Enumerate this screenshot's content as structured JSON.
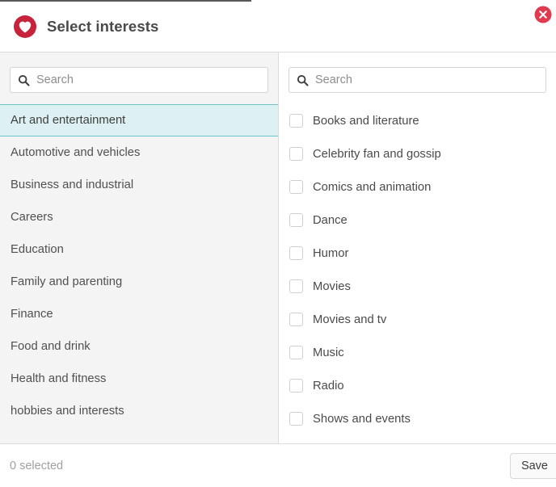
{
  "header": {
    "title": "Select interests",
    "brand_icon": "heart-circle-icon",
    "brand_color": "#c8233c",
    "close_icon": "close-circle-icon",
    "close_color": "#e03a4e"
  },
  "left_panel": {
    "search": {
      "placeholder": "Search",
      "value": "",
      "icon": "search-icon"
    },
    "selected_index": 0,
    "selected_color": "#ddf0f2",
    "selected_border_color": "#6cc3cb",
    "categories": [
      {
        "label": "Art and entertainment"
      },
      {
        "label": "Automotive and vehicles"
      },
      {
        "label": "Business and industrial"
      },
      {
        "label": "Careers"
      },
      {
        "label": "Education"
      },
      {
        "label": "Family and parenting"
      },
      {
        "label": "Finance"
      },
      {
        "label": "Food and drink"
      },
      {
        "label": "Health and fitness"
      },
      {
        "label": "hobbies and interests"
      }
    ]
  },
  "right_panel": {
    "search": {
      "placeholder": "Search",
      "value": "",
      "icon": "search-icon"
    },
    "interests": [
      {
        "label": "Books and literature",
        "checked": false
      },
      {
        "label": "Celebrity fan and gossip",
        "checked": false
      },
      {
        "label": "Comics and animation",
        "checked": false
      },
      {
        "label": "Dance",
        "checked": false
      },
      {
        "label": "Humor",
        "checked": false
      },
      {
        "label": "Movies",
        "checked": false
      },
      {
        "label": "Movies and tv",
        "checked": false
      },
      {
        "label": "Music",
        "checked": false
      },
      {
        "label": "Radio",
        "checked": false
      },
      {
        "label": "Shows and events",
        "checked": false
      }
    ]
  },
  "footer": {
    "status": "0 selected",
    "save_label": "Save"
  }
}
